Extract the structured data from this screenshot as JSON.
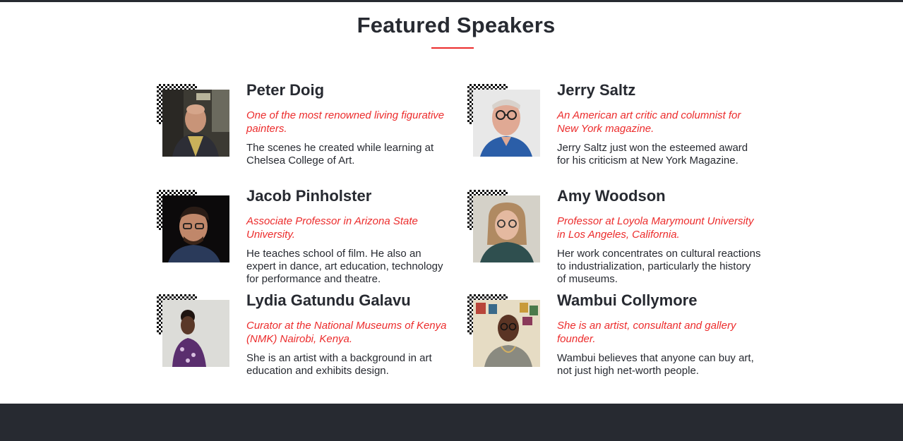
{
  "section": {
    "title": "Featured Speakers"
  },
  "speakers": [
    {
      "name": "Peter Doig",
      "role": "One of the most renowned living figurative painters.",
      "bio": "The scenes he created while learning at Chelsea College of Art."
    },
    {
      "name": "Jerry Saltz",
      "role": "An American art critic and columnist for New York magazine.",
      "bio": "Jerry Saltz just won the esteemed award for his criticism at New York Magazine."
    },
    {
      "name": "Jacob Pinholster",
      "role": "Associate Professor in Arizona State University.",
      "bio": "He teaches school of film. He also an expert in dance, art education, technology for performance and theatre."
    },
    {
      "name": "Amy Woodson",
      "role": "Professor at Loyola Marymount University in Los Angeles, California.",
      "bio": "Her work concentrates on cultural reactions to industrialization, particularly the history of museums."
    },
    {
      "name": "Lydia Gatundu Galavu",
      "role": "Curator at the National Museums of Kenya (NMK) Nairobi, Kenya.",
      "bio": "She is an artist with a background in art education and exhibits design."
    },
    {
      "name": "Wambui Collymore",
      "role": "She is an artist, consultant and gallery founder.",
      "bio": "Wambui believes that anyone can buy art, not just high net-worth people."
    }
  ],
  "colors": {
    "accent": "#ec2c2c",
    "text": "#272a31",
    "footer": "#272a31"
  }
}
